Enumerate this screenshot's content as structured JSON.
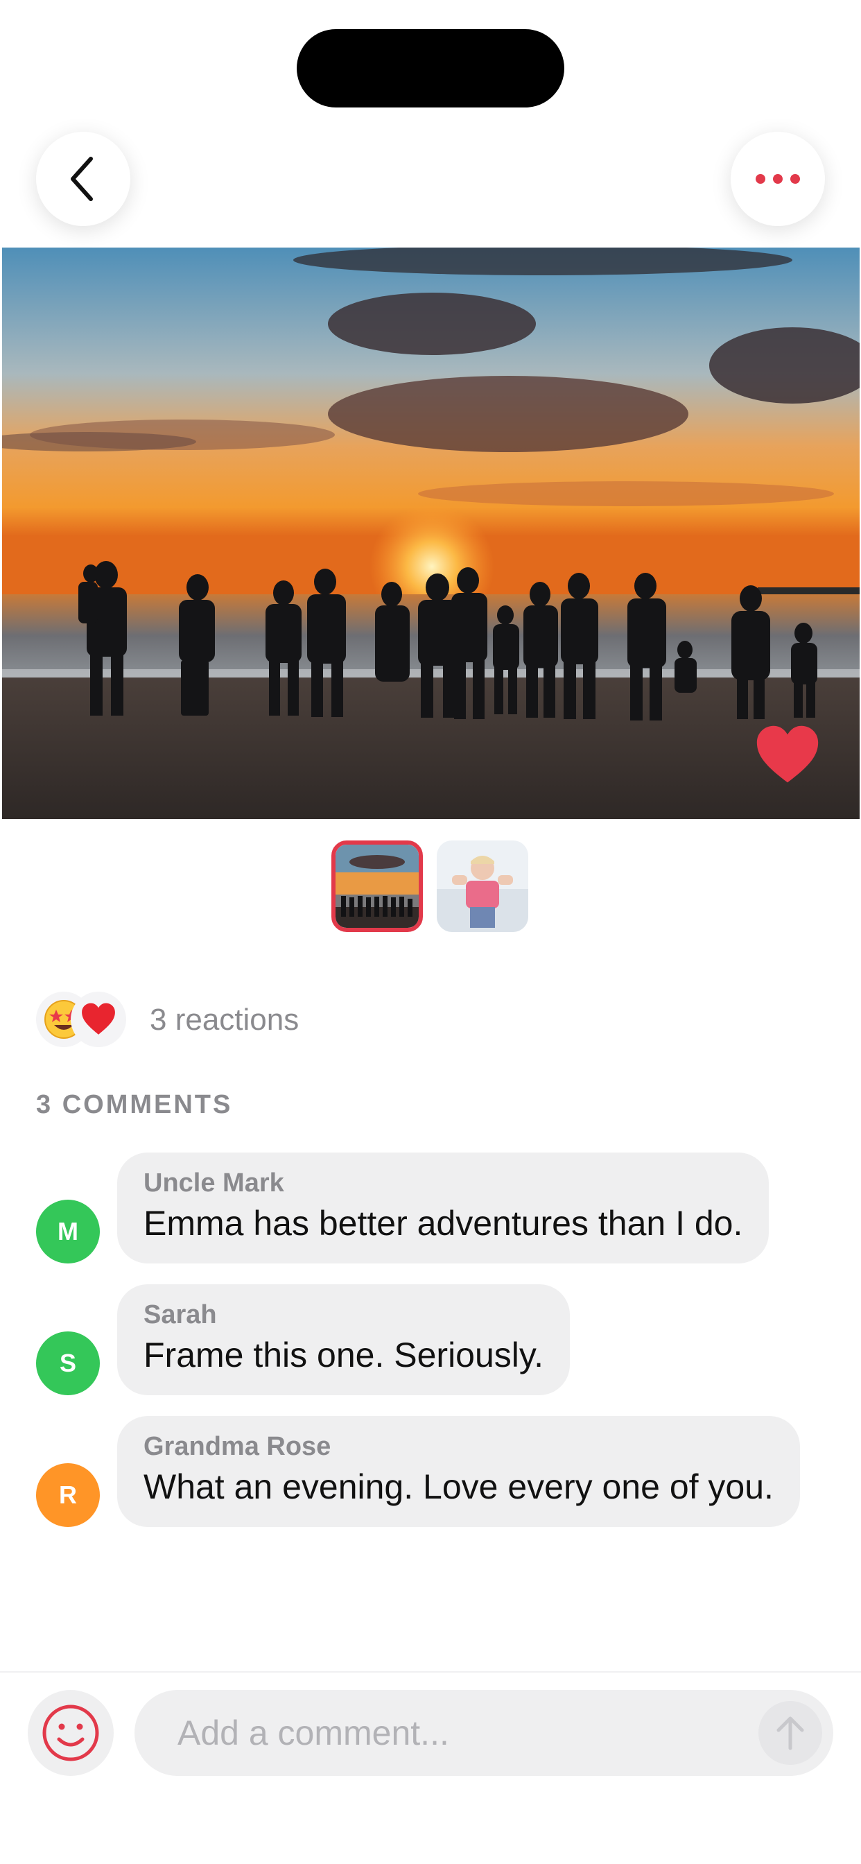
{
  "nav": {
    "back_icon": "chevron-left-icon",
    "more_icon": "ellipsis-icon",
    "accent_color": "#e2394a"
  },
  "photo": {
    "favorite_icon": "heart-icon",
    "thumbnails": [
      {
        "name": "beach-sunset-group",
        "selected": true
      },
      {
        "name": "child-flexing",
        "selected": false
      }
    ]
  },
  "reactions": {
    "emojis": [
      "🤩",
      "❤️"
    ],
    "count_label": "3 reactions"
  },
  "comments": {
    "header": "3 COMMENTS",
    "items": [
      {
        "initial": "M",
        "author": "Uncle Mark",
        "text": "Emma has better adventures than I do.",
        "avatar_color": "#34c759"
      },
      {
        "initial": "S",
        "author": "Sarah",
        "text": "Frame this one. Seriously.",
        "avatar_color": "#34c759"
      },
      {
        "initial": "R",
        "author": "Grandma Rose",
        "text": "What an evening. Love every one of you.",
        "avatar_color": "#ff9527"
      }
    ]
  },
  "composer": {
    "emoji_icon": "smiley-icon",
    "placeholder": "Add a comment...",
    "send_icon": "arrow-up-icon"
  }
}
